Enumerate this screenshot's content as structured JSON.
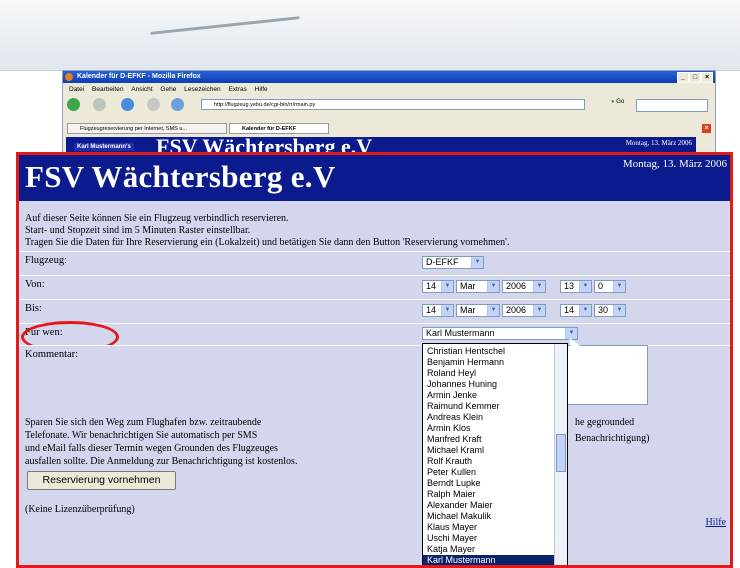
{
  "browser": {
    "window_title": "Kalender für D-EFKF - Mozilla Firefox",
    "menu": [
      "Datei",
      "Bearbeiten",
      "Ansicht",
      "Gehe",
      "Lesezeichen",
      "Extras",
      "Hilfe"
    ],
    "url": "http://flugzeug.yebu.de/cgi-bin/rr/rmain.py",
    "go_label": "Go",
    "tabs": [
      "Flugzeugreservierung per Internet, SMS u...",
      "Kalender für D-EFKF"
    ],
    "peek": {
      "user": "Karl Mustermann's",
      "title": "FSV Wächtersberg e.V",
      "date": "Montag, 13. März 2006"
    }
  },
  "page": {
    "title": "FSV Wächtersberg e.V",
    "date": "Montag, 13. März 2006",
    "intro": [
      "Auf dieser Seite können Sie ein Flugzeug verbindlich reservieren.",
      "Start- und Stopzeit sind im 5 Minuten Raster einstellbar.",
      "Tragen Sie die Daten für Ihre Reservierung ein (Lokalzeit) und betätigen Sie dann den Button 'Reservierung vornehmen'."
    ],
    "form": {
      "flugzeug_label": "Flugzeug:",
      "flugzeug_value": "D-EFKF",
      "von_label": "Von:",
      "von": {
        "day": "14",
        "month": "Mar",
        "year": "2006",
        "hour": "13",
        "minute": "0"
      },
      "bis_label": "Bis:",
      "bis": {
        "day": "14",
        "month": "Mar",
        "year": "2006",
        "hour": "14",
        "minute": "30"
      },
      "fuer_wen_label": "Für wen:",
      "fuer_wen_value": "Karl Mustermann",
      "kommentar_label": "Kommentar:"
    },
    "notify_text": [
      "Sparen Sie sich den Weg zum Flughafen bzw. zeitraubende",
      "Telefonate. Wir benachrichtigen Sie automatisch per SMS",
      "und eMail falls dieser Termin wegen Grounden des Flugzeuges",
      "ausfallen sollte. Die Anmeldung zur Benachrichtigung ist kostenlos."
    ],
    "notify_right": [
      "he gegrounded",
      "Benachrichtigung)"
    ],
    "reserve_button": "Reservierung vornehmen",
    "license_note": "(Keine Lizenzüberprüfung)",
    "help_link": "Hilfe",
    "dropdown_options": [
      "Christian Hentschel",
      "Benjamin Hermann",
      "Roland Heyl",
      "Johannes Huning",
      "Armin Jenke",
      "Raimund Kemmer",
      "Andreas Klein",
      "Armin Klos",
      "Manfred Kraft",
      "Michael Kraml",
      "Rolf Krauth",
      "Peter Kullen",
      "Berndt Lupke",
      "Ralph Maier",
      "Alexander Maier",
      "Michael Makulik",
      "Klaus Mayer",
      "Uschi Mayer",
      "Katja Mayer",
      "Karl Mustermann"
    ],
    "dropdown_selected_index": 19
  }
}
